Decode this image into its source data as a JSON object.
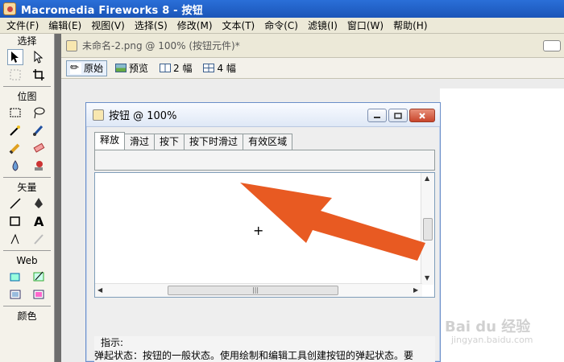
{
  "window": {
    "title": "Macromedia Fireworks 8 - 按钮"
  },
  "menu": [
    "文件(F)",
    "编辑(E)",
    "视图(V)",
    "选择(S)",
    "修改(M)",
    "文本(T)",
    "命令(C)",
    "滤镜(I)",
    "窗口(W)",
    "帮助(H)"
  ],
  "tools": {
    "section_select": "选择",
    "section_bitmap": "位图",
    "section_vector": "矢量",
    "section_web": "Web",
    "section_color": "颜色"
  },
  "document": {
    "tab_title": "未命名-2.png @ 100% (按钮元件)*",
    "views": [
      "原始",
      "预览",
      "2 幅",
      "4 幅"
    ]
  },
  "button_editor": {
    "title": "按钮 @ 100%",
    "tabs": [
      "释放",
      "滑过",
      "按下",
      "按下时滑过",
      "有效区域"
    ],
    "hint_label": "指示:",
    "hint_text": "弹起状态：按钮的一般状态。使用绘制和编辑工具创建按钮的弹起状态。要"
  },
  "watermark": {
    "logo": "Bai du 经验",
    "site": "jingyan.baidu.com"
  },
  "colors": {
    "title_bar": "#1e5fc9",
    "annotation_arrow": "#e85a22"
  }
}
